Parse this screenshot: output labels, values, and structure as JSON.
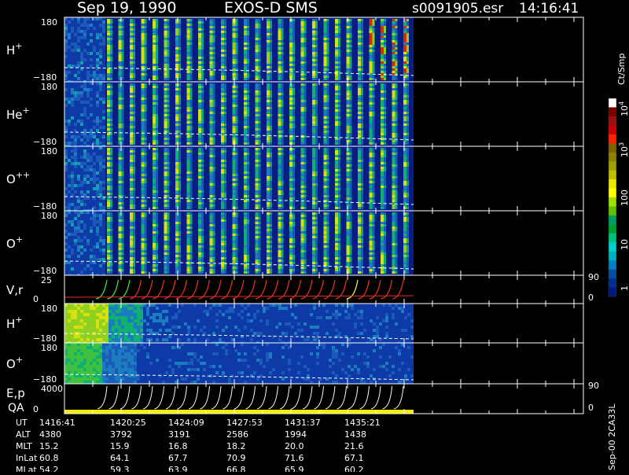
{
  "header": {
    "date": "Sep 19, 1990",
    "instrument": "EXOS-D SMS",
    "file": "s0091905.esr",
    "time": "14:16:41"
  },
  "colorbar": {
    "title": "Ct/Smp",
    "tick_labels": [
      "1",
      "10",
      "100",
      "10",
      "10"
    ],
    "tick_exponents": [
      "",
      "",
      "",
      "3",
      "4"
    ],
    "colors": [
      "#ffffff",
      "#7b0000",
      "#9a1010",
      "#cc0000",
      "#ff2000",
      "#806000",
      "#908000",
      "#a0a000",
      "#c0c000",
      "#e8e800",
      "#ffff00",
      "#a0e000",
      "#60c000",
      "#00a060",
      "#00a030",
      "#00c080",
      "#00d0d0",
      "#00b0c0",
      "#0080c0",
      "#0050a0",
      "#003090",
      "#001880"
    ],
    "range": [
      1,
      10000
    ],
    "scale": "log"
  },
  "side_label": "Sep-00 2CA33L",
  "chart_data": {
    "type": "heatmap",
    "x": [
      "1416:41",
      "1420:25",
      "1424:09",
      "1427:53",
      "1431:37",
      "1435:21"
    ],
    "panels": [
      {
        "name": "H",
        "superscript": "+",
        "ylim": [
          -180,
          180
        ],
        "tick_top": "180",
        "tick_bottom": "-180"
      },
      {
        "name": "He",
        "superscript": "+",
        "ylim": [
          -180,
          180
        ],
        "tick_top": "180",
        "tick_bottom": "-180"
      },
      {
        "name": "O",
        "superscript": "++",
        "ylim": [
          -180,
          180
        ],
        "tick_top": "180",
        "tick_bottom": "-180"
      },
      {
        "name": "O",
        "superscript": "+",
        "ylim": [
          -180,
          180
        ],
        "tick_top": "180",
        "tick_bottom": "-180"
      },
      {
        "name": "V,r",
        "superscript": "",
        "ylim": [
          0,
          25
        ],
        "tick_top": "25",
        "tick_bottom": "0",
        "right_top": "90",
        "right_bottom": "0"
      },
      {
        "name": "H",
        "superscript": "+",
        "ylim": [
          -180,
          180
        ],
        "tick_top": "180",
        "tick_bottom": "-180"
      },
      {
        "name": "O",
        "superscript": "+",
        "ylim": [
          -180,
          180
        ],
        "tick_top": "180",
        "tick_bottom": "-180"
      },
      {
        "name": "E,p",
        "name2": "QA",
        "superscript": "",
        "ylim": [
          0,
          4000
        ],
        "tick_top": "4000",
        "tick_bottom": "0",
        "right_top": "90",
        "right_bottom": "0"
      }
    ],
    "ephemeris": {
      "labels": [
        "UT",
        "ALT",
        "MLT",
        "InLat",
        "MLat"
      ],
      "rows": [
        [
          "1416:41",
          "1420:25",
          "1424:09",
          "1427:53",
          "1431:37",
          "1435:21"
        ],
        [
          "4380",
          "3792",
          "3191",
          "2586",
          "1994",
          "1438"
        ],
        [
          "15.2",
          "15.9",
          "16.8",
          "18.2",
          "20.0",
          "21.6"
        ],
        [
          "60.8",
          "64.1",
          "67.7",
          "70.9",
          "71.6",
          "67.1"
        ],
        [
          "54.2",
          "59.3",
          "63.9",
          "66.8",
          "65.9",
          "60.2"
        ]
      ]
    }
  }
}
